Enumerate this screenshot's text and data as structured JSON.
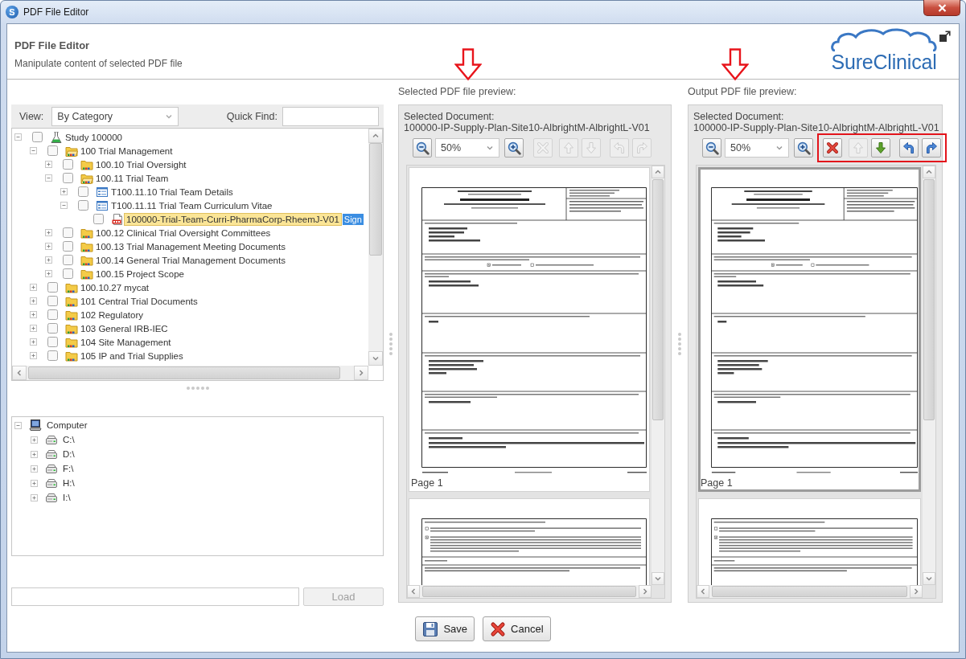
{
  "window": {
    "title": "PDF File Editor",
    "icon_letter": "S"
  },
  "header": {
    "title": "PDF File Editor",
    "subtitle": "Manipulate content of selected PDF file",
    "logo_text": "SureClinical"
  },
  "filter": {
    "view_label": "View:",
    "view_value": "By Category",
    "find_label": "Quick Find:"
  },
  "tree": [
    {
      "label": "Study 100000",
      "kind": "study",
      "expanded": true,
      "checked": false,
      "selected": false,
      "children": [
        {
          "label": "100 Trial Management",
          "kind": "folder",
          "expanded": true,
          "checked": false,
          "selected": false,
          "children": [
            {
              "label": "100.10 Trial Oversight",
              "kind": "folder",
              "expanded": false,
              "checked": false,
              "selected": false
            },
            {
              "label": "100.11 Trial Team",
              "kind": "folder",
              "expanded": true,
              "checked": false,
              "selected": false,
              "children": [
                {
                  "label": "T100.11.10 Trial Team Details",
                  "kind": "form",
                  "expanded": false,
                  "checked": false,
                  "selected": false
                },
                {
                  "label": "T100.11.11 Trial Team Curriculum Vitae",
                  "kind": "form",
                  "expanded": true,
                  "checked": false,
                  "selected": false,
                  "children": [
                    {
                      "label": "100000-Trial-Team-Curri-PharmaCorp-RheemJ-V01",
                      "kind": "pdf",
                      "checked": false,
                      "selected": true,
                      "tag": "Sign"
                    }
                  ]
                }
              ]
            },
            {
              "label": "100.12 Clinical Trial Oversight Committees",
              "kind": "folder",
              "expanded": false,
              "checked": false,
              "selected": false
            },
            {
              "label": "100.13 Trial Management Meeting Documents",
              "kind": "folder",
              "expanded": false,
              "checked": false,
              "selected": false
            },
            {
              "label": "100.14 General Trial Management Documents",
              "kind": "folder",
              "expanded": false,
              "checked": false,
              "selected": false
            },
            {
              "label": "100.15 Project Scope",
              "kind": "folder",
              "expanded": false,
              "checked": false,
              "selected": false
            }
          ]
        },
        {
          "label": "100.10.27 mycat",
          "kind": "folder",
          "expanded": false,
          "checked": false,
          "selected": false
        },
        {
          "label": "101 Central Trial Documents",
          "kind": "folder",
          "expanded": false,
          "checked": false,
          "selected": false
        },
        {
          "label": "102 Regulatory",
          "kind": "folder",
          "expanded": false,
          "checked": false,
          "selected": false
        },
        {
          "label": "103 General IRB-IEC",
          "kind": "folder",
          "expanded": false,
          "checked": false,
          "selected": false
        },
        {
          "label": "104 Site Management",
          "kind": "folder",
          "expanded": false,
          "checked": false,
          "selected": false
        },
        {
          "label": "105 IP and Trial Supplies",
          "kind": "folder",
          "expanded": false,
          "checked": false,
          "selected": false
        }
      ]
    }
  ],
  "computer_tree": [
    {
      "label": "Computer",
      "kind": "computer",
      "expanded": true,
      "children": [
        {
          "label": "C:\\",
          "kind": "drive",
          "expanded": false
        },
        {
          "label": "D:\\",
          "kind": "drive",
          "expanded": false
        },
        {
          "label": "F:\\",
          "kind": "drive",
          "expanded": false
        },
        {
          "label": "H:\\",
          "kind": "drive",
          "expanded": false
        },
        {
          "label": "I:\\",
          "kind": "drive",
          "expanded": false
        }
      ]
    }
  ],
  "load_button": {
    "label": "Load",
    "disabled": true
  },
  "previews": [
    {
      "heading": "Selected PDF file preview:",
      "arrow_marker": true,
      "document_label": "Selected Document:",
      "document_name": "100000-IP-Supply-Plan-Site10-AlbrightM-AlbrightL-V01",
      "zoom": "50%",
      "tools_highlighted": false,
      "tools": [
        {
          "kind": "delete",
          "disabled": true
        },
        {
          "kind": "move_up",
          "disabled": true
        },
        {
          "kind": "move_down",
          "disabled": true
        },
        {
          "kind": "rotate_left",
          "disabled": true
        },
        {
          "kind": "rotate_right",
          "disabled": true
        }
      ],
      "pages": [
        {
          "label": "Page 1",
          "selected": false
        },
        {
          "selected": false
        }
      ]
    },
    {
      "heading": "Output PDF file preview:",
      "arrow_marker": true,
      "document_label": "Selected Document:",
      "document_name": "100000-IP-Supply-Plan-Site10-AlbrightM-AlbrightL-V01",
      "zoom": "50%",
      "tools_highlighted": true,
      "tools": [
        {
          "kind": "delete",
          "disabled": false
        },
        {
          "kind": "move_up",
          "disabled": true
        },
        {
          "kind": "move_down",
          "disabled": false
        },
        {
          "kind": "rotate_left",
          "disabled": false
        },
        {
          "kind": "rotate_right",
          "disabled": false
        }
      ],
      "pages": [
        {
          "label": "Page 1",
          "selected": true
        },
        {
          "selected": false
        }
      ]
    }
  ],
  "buttons": [
    {
      "kind": "save",
      "label": "Save"
    },
    {
      "kind": "cancel",
      "label": "Cancel"
    }
  ]
}
